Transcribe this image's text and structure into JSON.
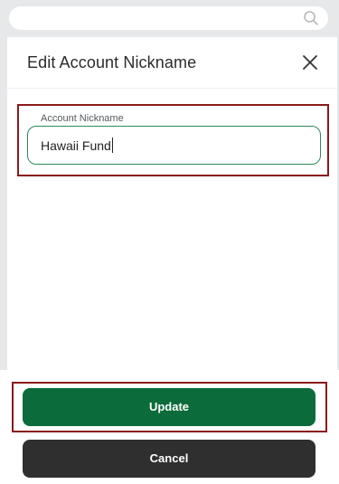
{
  "modal": {
    "title": "Edit Account Nickname"
  },
  "nickname_field": {
    "label": "Account Nickname",
    "value": "Hawaii Fund"
  },
  "actions": {
    "update_label": "Update",
    "cancel_label": "Cancel"
  },
  "colors": {
    "primary": "#0b6b3a",
    "secondary": "#2f2f2f",
    "highlight": "#8a1a1a",
    "input_border": "#2e8a5a"
  },
  "icons": {
    "search": "search-icon",
    "close": "close-icon"
  }
}
